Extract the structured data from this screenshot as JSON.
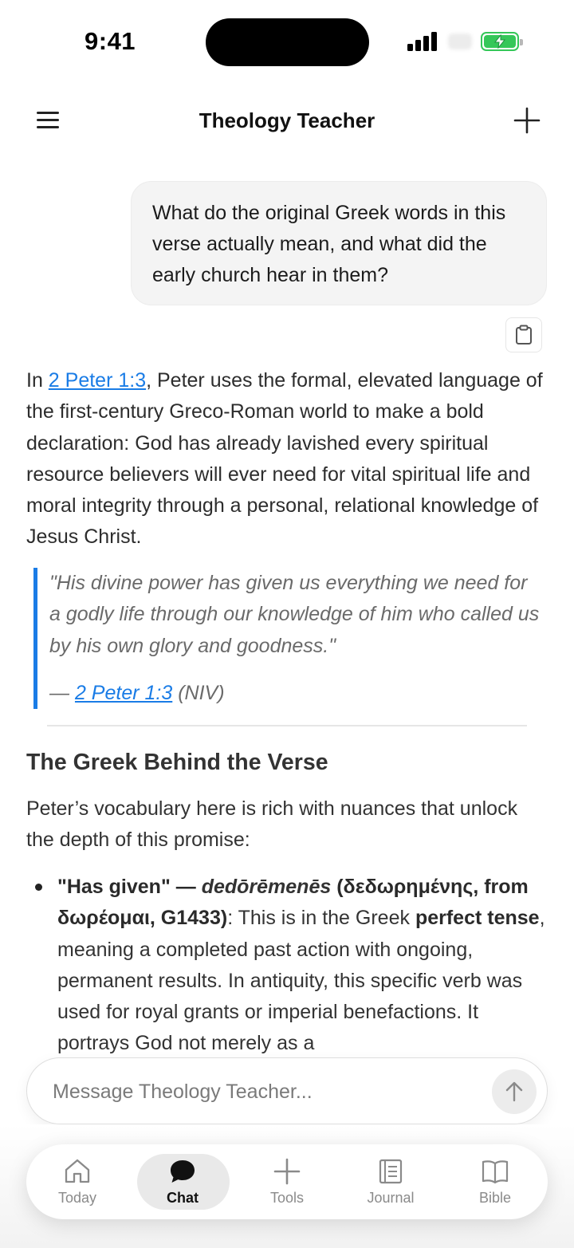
{
  "status_bar": {
    "time": "9:41",
    "battery_color": "#35c759"
  },
  "header": {
    "title": "Theology Teacher",
    "menu_icon": "hamburger-menu-icon",
    "new_chat_icon": "plus-icon"
  },
  "user_message": {
    "text": "What do the original Greek words in this verse actually mean, and what did the early church hear in them?",
    "copy_icon": "clipboard-icon"
  },
  "assistant_message": {
    "intro_prefix": "In ",
    "intro_link": "2 Peter 1:3",
    "intro_rest": ", Peter uses the formal, elevated language of the first-century Greco-Roman world to make a bold declaration: God has already lavished every spiritual resource believers will ever need for vital spiritual life and moral integrity through a personal, relational knowledge of Jesus Christ.",
    "quote": {
      "text": "\"His divine power has given us everything we need for a godly life through our knowledge of him who called us by his own glory and goodness.\"",
      "cite_dash": "— ",
      "cite_link": "2 Peter 1:3",
      "cite_version": " (NIV)"
    },
    "section_heading": "The Greek Behind the Verse",
    "section_intro": "Peter’s vocabulary here is rich with nuances that unlock the depth of this promise:",
    "bullets": [
      {
        "bold_prefix": "\"Has given\" — ",
        "bold_italic": "dedōrēmenēs",
        "bold_suffix": " (δεδωρημένης, from δωρέομαι, G1433)",
        "text_1": ": This is in the Greek ",
        "bold_mid": "perfect tense",
        "text_2": ", meaning a completed past action with ongoing, permanent results. In antiquity, this specific verb was used for royal grants or imperial benefactions. It portrays God not merely as a"
      }
    ]
  },
  "composer": {
    "placeholder": "Message Theology Teacher...",
    "send_icon": "arrow-up-icon"
  },
  "tab_bar": {
    "active": "Chat",
    "tabs": [
      {
        "label": "Today",
        "icon": "home-icon"
      },
      {
        "label": "Chat",
        "icon": "chat-bubble-icon"
      },
      {
        "label": "Tools",
        "icon": "plus-icon"
      },
      {
        "label": "Journal",
        "icon": "journal-icon"
      },
      {
        "label": "Bible",
        "icon": "open-book-icon"
      }
    ]
  },
  "colors": {
    "link": "#1a7ce6",
    "quote_border": "#1a7ce6",
    "bubble_bg": "#f4f4f4"
  }
}
